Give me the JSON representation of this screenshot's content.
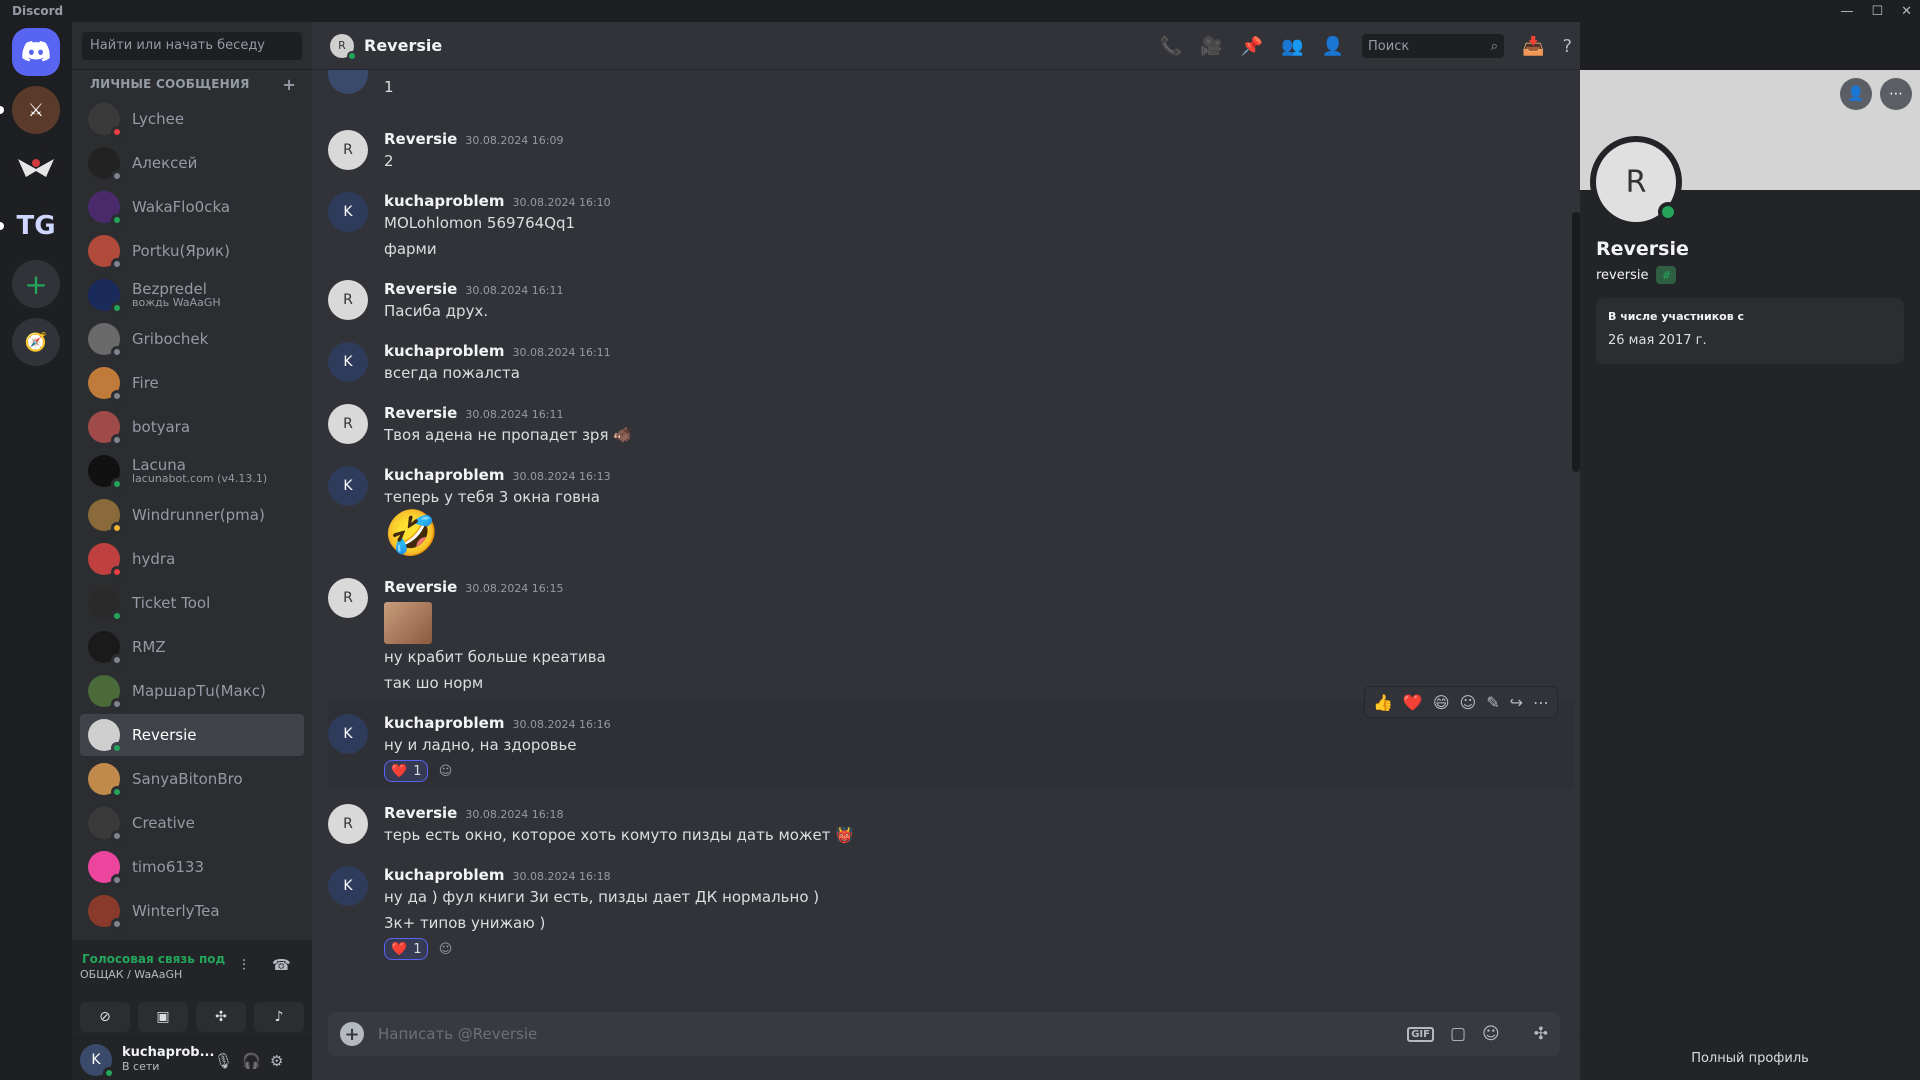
{
  "app": {
    "title": "Discord"
  },
  "servers": [
    {
      "name": "home",
      "label": ""
    },
    {
      "name": "server-1",
      "label": ""
    },
    {
      "name": "server-2",
      "label": ""
    },
    {
      "name": "server-tg",
      "label": "TG"
    }
  ],
  "dm": {
    "search_placeholder": "Найти или начать беседу",
    "header": "ЛИЧНЫЕ СООБЩЕНИЯ",
    "items": [
      {
        "name": "Lychee",
        "sub": "",
        "color": "#3a3a3a",
        "status": "#f23f43"
      },
      {
        "name": "Алексей",
        "sub": "",
        "color": "#222222",
        "status": "#80848e"
      },
      {
        "name": "WakaFlo0cka",
        "sub": "",
        "color": "#4a2a6a",
        "status": "#23a55a"
      },
      {
        "name": "Portku(Ярик)",
        "sub": "",
        "color": "#b04a3a",
        "status": "#80848e"
      },
      {
        "name": "Bezpredel",
        "sub": "вождь WaAaGH",
        "color": "#1a2a5a",
        "status": "#23a55a"
      },
      {
        "name": "Gribochek",
        "sub": "",
        "color": "#6a6a6a",
        "status": "#80848e"
      },
      {
        "name": "Fire",
        "sub": "",
        "color": "#c07a3a",
        "status": "#80848e"
      },
      {
        "name": "botyara",
        "sub": "",
        "color": "#a04a4a",
        "status": "#80848e"
      },
      {
        "name": "Lacuna",
        "sub": "lacunabot.com (v4.13.1)",
        "color": "#111111",
        "status": "#23a55a"
      },
      {
        "name": "Windrunner(pma)",
        "sub": "",
        "color": "#8a6a3a",
        "status": "#f0b232"
      },
      {
        "name": "hydra",
        "sub": "",
        "color": "#c04040",
        "status": "#f23f43"
      },
      {
        "name": "Ticket Tool",
        "sub": "",
        "color": "#2a2a2a",
        "status": "#23a55a"
      },
      {
        "name": "RMZ",
        "sub": "",
        "color": "#1a1a1a",
        "status": "#80848e"
      },
      {
        "name": "МаршарТu(Макс)",
        "sub": "",
        "color": "#4a6a3a",
        "status": "#80848e"
      },
      {
        "name": "Reversie",
        "sub": "",
        "color": "#cfcfcf",
        "status": "#23a55a",
        "active": true
      },
      {
        "name": "SanyaBitonBro",
        "sub": "",
        "color": "#c08a4a",
        "status": "#23a55a"
      },
      {
        "name": "Creative",
        "sub": "",
        "color": "#3a3a3a",
        "status": "#80848e"
      },
      {
        "name": "timo6133",
        "sub": "",
        "color": "#eb459e",
        "status": "#80848e"
      },
      {
        "name": "WinterlyTea",
        "sub": "",
        "color": "#8a3a2a",
        "status": "#80848e"
      }
    ]
  },
  "voice": {
    "title": "Голосовая связь под",
    "sub": "ОБЩАК / WaAaGH"
  },
  "user": {
    "name": "kuchaprob...",
    "status": "В сети"
  },
  "chat": {
    "title": "Reversie",
    "search_placeholder": "Поиск",
    "composer_placeholder": "Написать @Reversie",
    "partial_top": "1",
    "messages": [
      {
        "author": "Reversie",
        "time": "30.08.2024 16:09",
        "lines": [
          "2"
        ]
      },
      {
        "author": "kuchaproblem",
        "time": "30.08.2024 16:10",
        "lines": [
          "MOLohlomon 569764Qq1",
          "фарми"
        ]
      },
      {
        "author": "Reversie",
        "time": "30.08.2024 16:11",
        "lines": [
          "Пасиба друх."
        ]
      },
      {
        "author": "kuchaproblem",
        "time": "30.08.2024 16:11",
        "lines": [
          "всегда пожалста"
        ]
      },
      {
        "author": "Reversie",
        "time": "30.08.2024 16:11",
        "lines": [
          "Твоя адена не пропадет зря 🐗"
        ]
      },
      {
        "author": "kuchaproblem",
        "time": "30.08.2024 16:13",
        "lines": [
          "теперь у тебя 3 окна говна"
        ],
        "emoji": "🤣"
      },
      {
        "author": "Reversie",
        "time": "30.08.2024 16:15",
        "image": true,
        "lines": [
          "ну крабит больше креатива",
          "так шо норм"
        ]
      },
      {
        "author": "kuchaproblem",
        "time": "30.08.2024 16:16",
        "lines": [
          "ну и ладно, на здоровье"
        ],
        "reaction": {
          "emoji": "❤️",
          "count": "1"
        },
        "hovered": true
      },
      {
        "author": "Reversie",
        "time": "30.08.2024 16:18",
        "lines": [
          "терь есть окно, которое хоть комуто пизды дать может 👹"
        ]
      },
      {
        "author": "kuchaproblem",
        "time": "30.08.2024 16:18",
        "lines": [
          "ну да ) фул книги 3и есть, пизды дает ДК нормально )",
          "3к+ типов унижаю )"
        ],
        "reaction": {
          "emoji": "❤️",
          "count": "1"
        }
      }
    ]
  },
  "profile": {
    "name": "Reversie",
    "handle": "reversie",
    "member_since_label": "В числе участников с",
    "member_since": "26 мая 2017 г.",
    "full_profile": "Полный профиль"
  }
}
